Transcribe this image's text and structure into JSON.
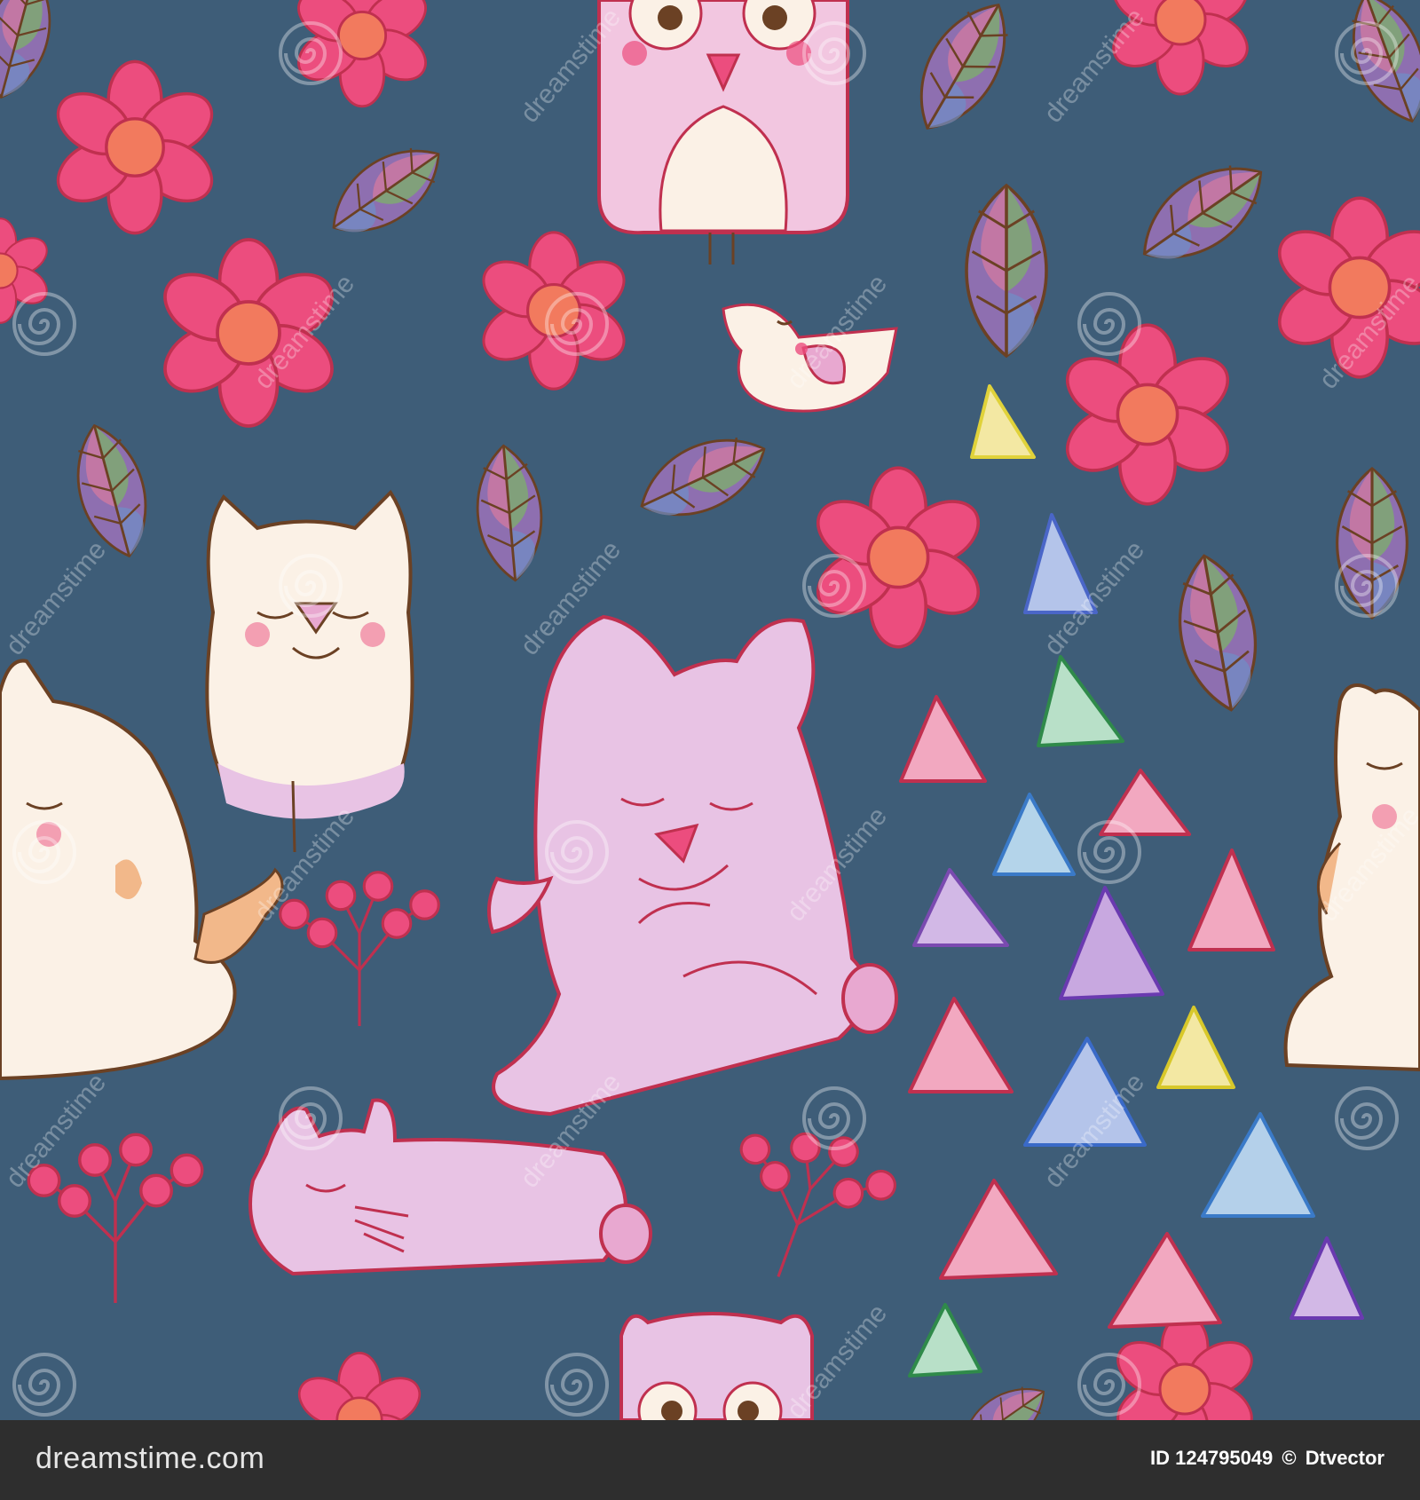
{
  "colors": {
    "background": "#3e5d78",
    "footer": "#2e2e2e",
    "flower_petal": "#ec4d7e",
    "flower_center": "#f27a5e",
    "cream_cat": "#fbf1e6",
    "pink_animal": "#e8c3e4",
    "outline_pink": "#c0304f",
    "outline_brown": "#6b4124"
  },
  "watermark": {
    "text": "dreamstime",
    "icon": "swirl-icon"
  },
  "footer": {
    "brand": "dreamstime.com",
    "id_label": "ID 124795049",
    "copyright_icon": "©",
    "author": "Dtvector"
  }
}
